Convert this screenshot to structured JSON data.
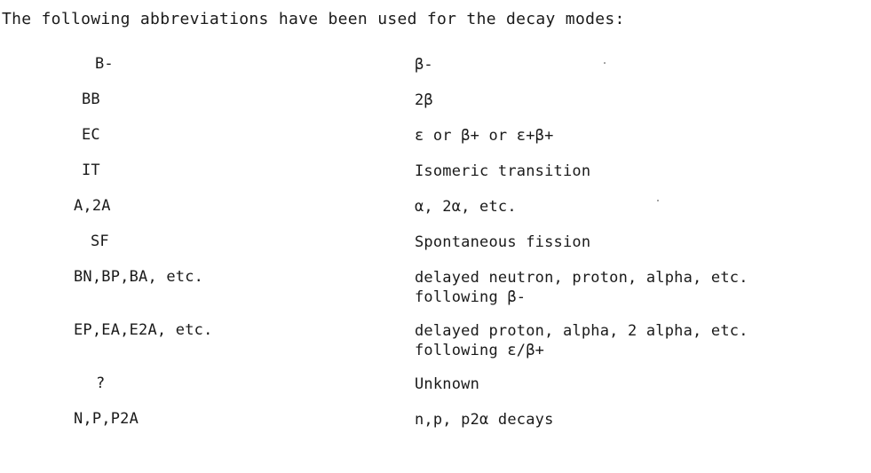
{
  "intro": "The following abbreviations have been used for the decay modes:",
  "rows": [
    {
      "code": "B-",
      "meaning": "β-",
      "meaning2": ""
    },
    {
      "code": "BB",
      "meaning": "2β",
      "meaning2": ""
    },
    {
      "code": "EC",
      "meaning": "ε or β+ or ε+β+",
      "meaning2": ""
    },
    {
      "code": "IT",
      "meaning": "Isomeric transition",
      "meaning2": ""
    },
    {
      "code": "A,2A",
      "meaning": "α, 2α, etc.",
      "meaning2": ""
    },
    {
      "code": "SF",
      "meaning": "Spontaneous fission",
      "meaning2": ""
    },
    {
      "code": "BN,BP,BA, etc.",
      "meaning": "delayed neutron, proton, alpha, etc.",
      "meaning2": "following β-"
    },
    {
      "code": "EP,EA,E2A, etc.",
      "meaning": "delayed proton, alpha, 2 alpha, etc.",
      "meaning2": "following ε/β+"
    },
    {
      "code": "?",
      "meaning": "Unknown",
      "meaning2": ""
    },
    {
      "code": "N,P,P2A",
      "meaning": "n,p, p2α decays",
      "meaning2": ""
    }
  ]
}
